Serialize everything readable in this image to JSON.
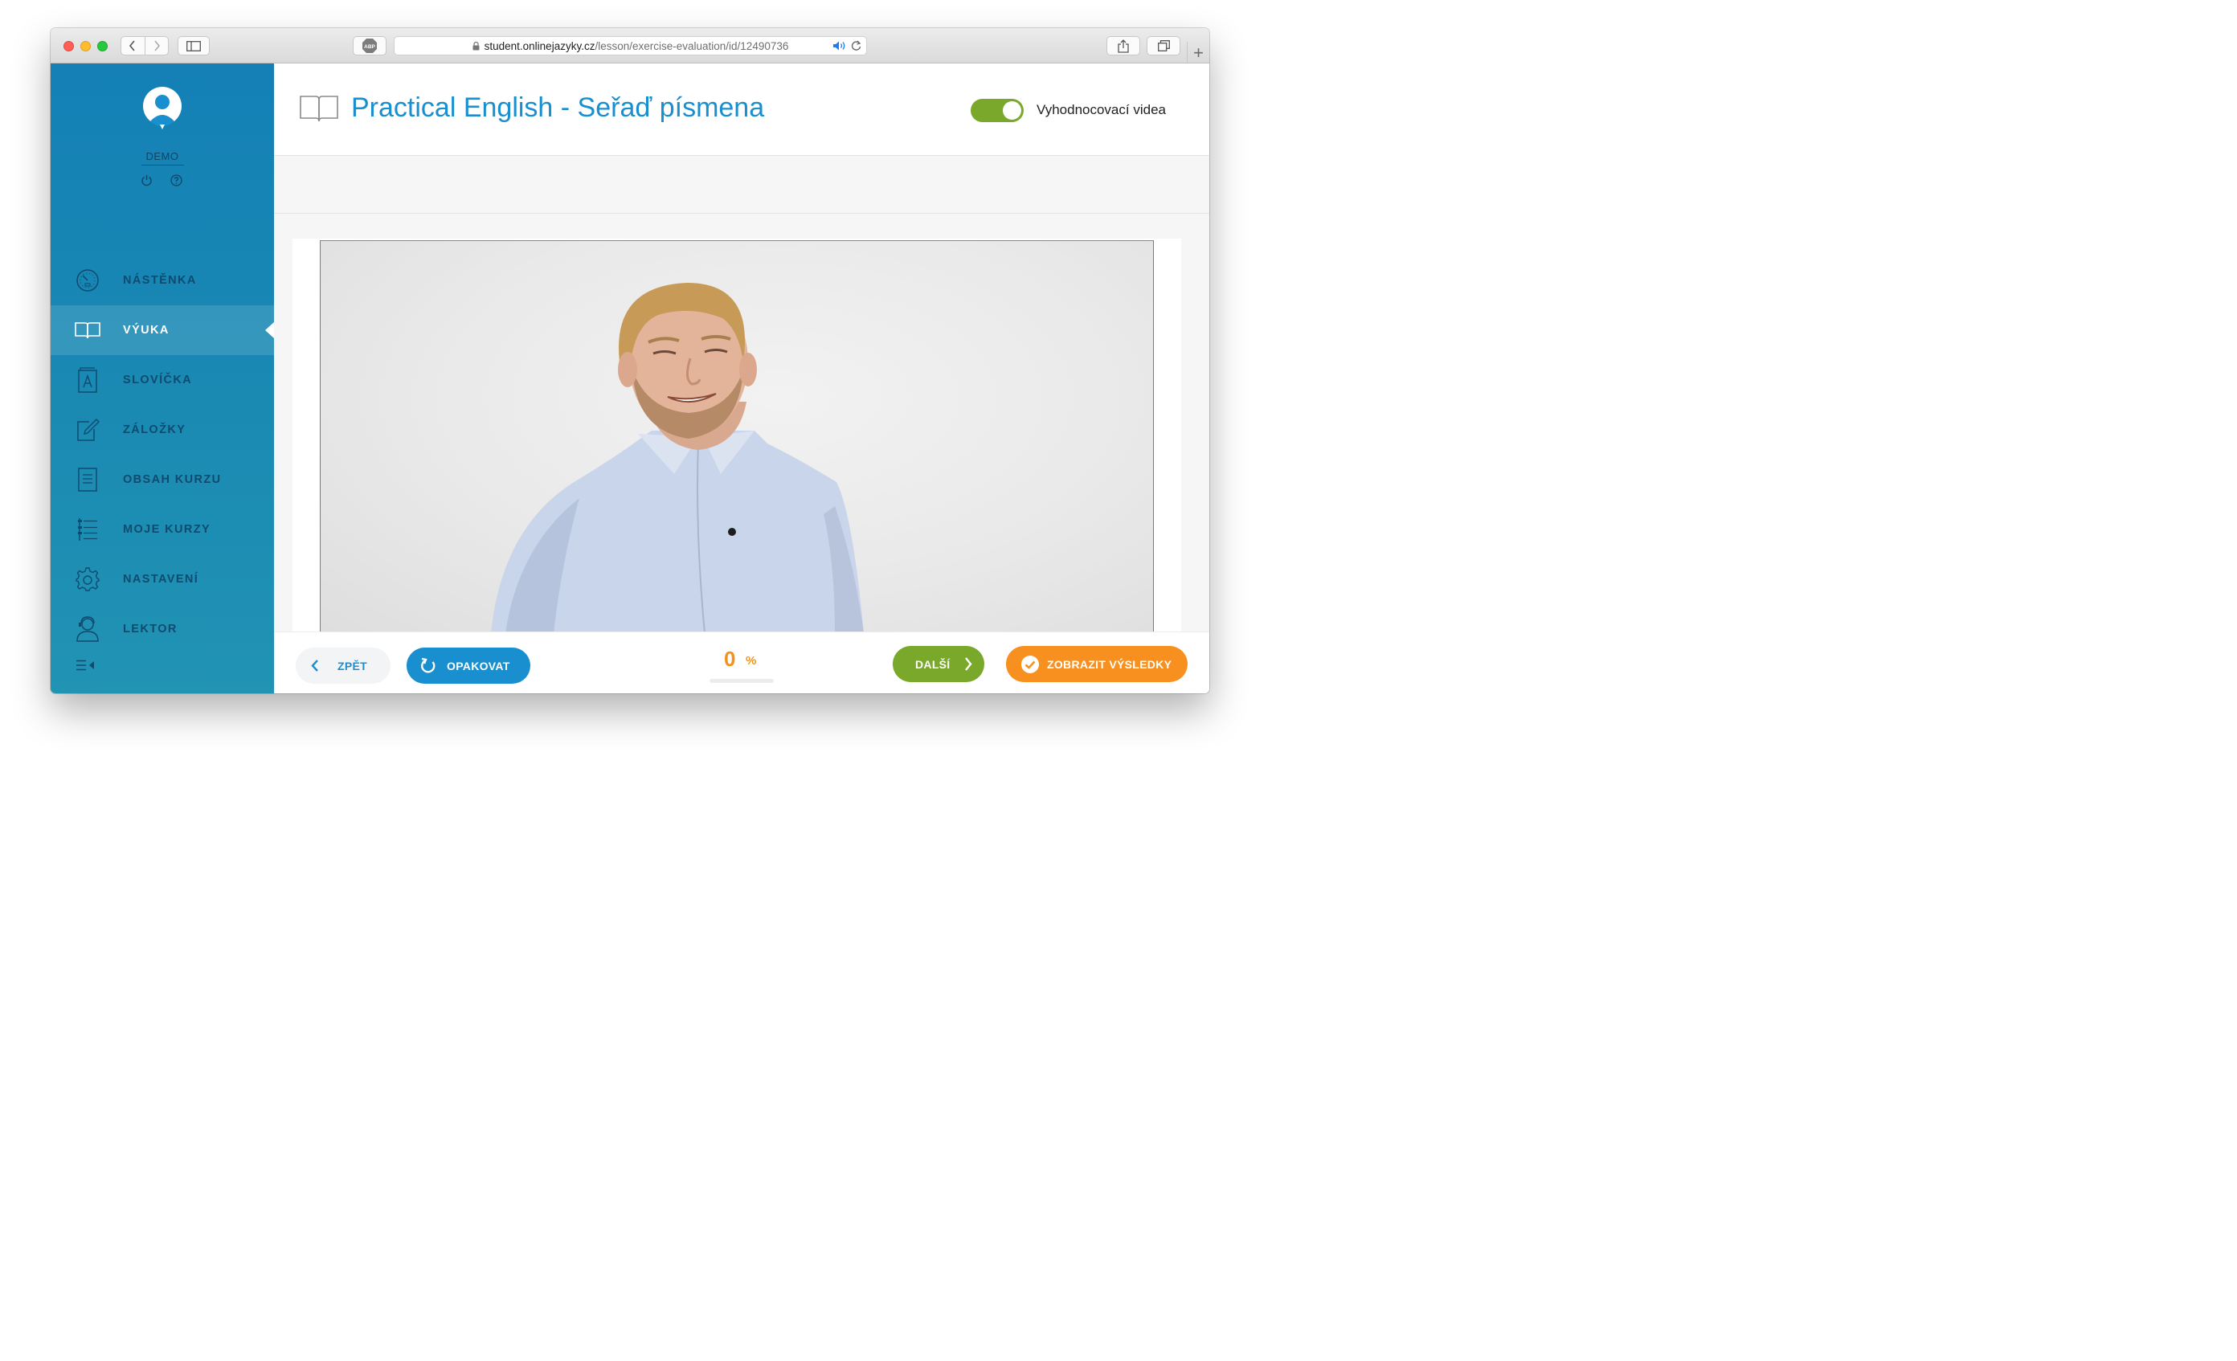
{
  "browser": {
    "url_domain": "student.onlinejazyky.cz",
    "url_path": "/lesson/exercise-evaluation/id/12490736",
    "abp_label": "ABP"
  },
  "sidebar": {
    "username": "DEMO",
    "items": [
      {
        "label": "NÁSTĚNKA",
        "icon": "dashboard-icon",
        "active": false
      },
      {
        "label": "VÝUKA",
        "icon": "book-icon",
        "active": true
      },
      {
        "label": "SLOVÍČKA",
        "icon": "vocabulary-icon",
        "active": false
      },
      {
        "label": "ZÁLOŽKY",
        "icon": "bookmark-edit-icon",
        "active": false
      },
      {
        "label": "OBSAH KURZU",
        "icon": "document-icon",
        "active": false
      },
      {
        "label": "MOJE KURZY",
        "icon": "course-list-icon",
        "active": false
      },
      {
        "label": "NASTAVENÍ",
        "icon": "gear-icon",
        "active": false
      },
      {
        "label": "LEKTOR",
        "icon": "lecturer-icon",
        "active": false
      }
    ]
  },
  "header": {
    "title": "Practical English - Seřaď písmena",
    "toggle_label": "Vyhodnocovací videa",
    "toggle_on": true
  },
  "footer": {
    "back_label": "ZPĚT",
    "repeat_label": "OPAKOVAT",
    "progress_value": "0",
    "progress_unit": "%",
    "next_label": "DALŠÍ",
    "results_label": "ZOBRAZIT VÝSLEDKY"
  },
  "colors": {
    "sidebar": "#1480b6",
    "accent_blue": "#1a8fcf",
    "green": "#7aa82b",
    "orange": "#f7901e"
  }
}
